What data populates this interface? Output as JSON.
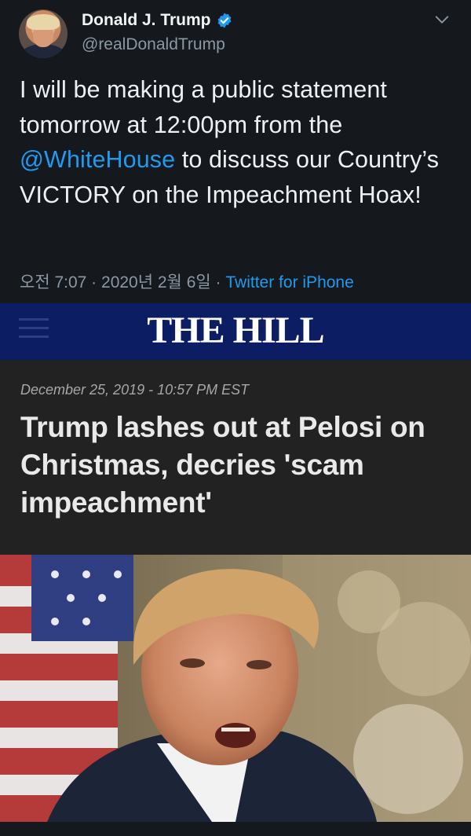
{
  "tweet": {
    "display_name": "Donald J. Trump",
    "handle": "@realDonaldTrump",
    "text_before": "I will be making a public statement tomorrow at 12:00pm from the ",
    "mention": "@WhiteHouse",
    "text_after": " to discuss our Country’s VICTORY on the Impeachment Hoax!",
    "timestamp": "오전 7:07 · 2020년 2월 6일 · ",
    "source": "Twitter for iPhone",
    "colors": {
      "accent": "#1d9bf0",
      "background": "#15181c"
    }
  },
  "article": {
    "publication": "THE HILL",
    "date": "December 25, 2019 - 10:57 PM EST",
    "headline": "Trump lashes out at Pelosi on Christmas, decries 'scam impeachment'",
    "colors": {
      "header_bar": "#0d1d63",
      "background": "#222222"
    }
  },
  "icons": {
    "verified": "verified-badge-icon",
    "chevron": "chevron-down-icon",
    "menu": "hamburger-menu-icon"
  }
}
